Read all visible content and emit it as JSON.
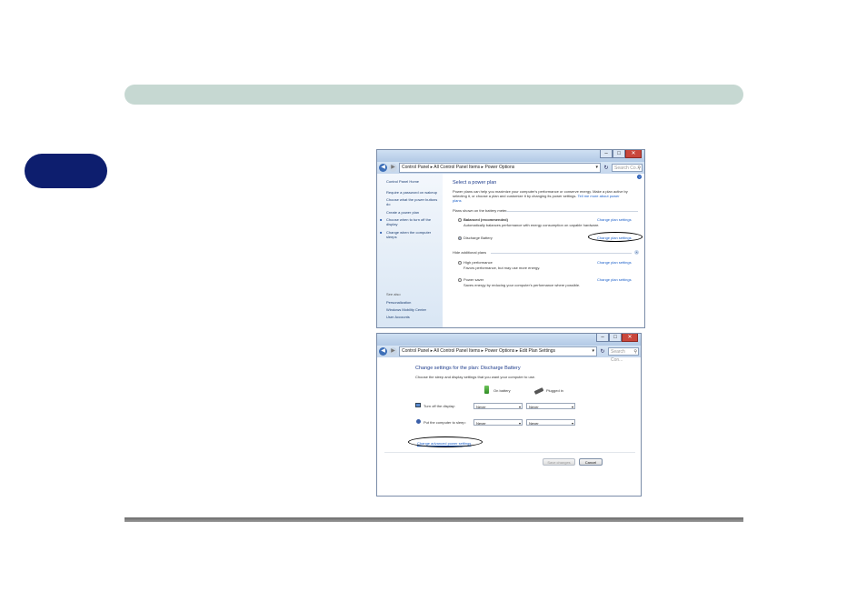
{
  "window1": {
    "address": "Control Panel  ▸  All Control Panel Items  ▸  Power Options",
    "search_placeholder": "Search Co...",
    "sidebar": {
      "home": "Control Panel Home",
      "items": [
        "Require a password on wakeup",
        "Choose what the power buttons do",
        "Create a power plan",
        "Choose when to turn off the display",
        "Change when the computer sleeps"
      ],
      "see_also": "See also",
      "links": [
        "Personalization",
        "Windows Mobility Center",
        "User Accounts"
      ]
    },
    "heading": "Select a power plan",
    "intro_line1": "Power plans can help you maximize your computer's performance or conserve energy. Make a plan active by",
    "intro_line2": "selecting it, or choose a plan and customize it by changing its power settings.",
    "intro_link": "Tell me more about power",
    "intro_link2": "plans",
    "battery_meter_label": "Plans shown on the battery meter",
    "plans": [
      {
        "name": "Balanced (recommended)",
        "desc": "Automatically balances performance with energy consumption on capable hardware.",
        "link": "Change plan settings",
        "selected": false
      },
      {
        "name": "Discharge Battery",
        "desc": "",
        "link": "Change plan settings",
        "selected": true
      }
    ],
    "hide_label": "Hide additional plans",
    "extra_plans": [
      {
        "name": "High performance",
        "desc": "Favors performance, but may use more energy.",
        "link": "Change plan settings"
      },
      {
        "name": "Power saver",
        "desc": "Saves energy by reducing your computer's performance where possible.",
        "link": "Change plan settings"
      }
    ]
  },
  "window2": {
    "address": "Control Panel  ▸  All Control Panel Items  ▸  Power Options  ▸  Edit Plan Settings",
    "search_placeholder": "Search Con...",
    "heading": "Change settings for the plan: Discharge Battery",
    "subheading": "Choose the sleep and display settings that you want your computer to use.",
    "on_battery": "On battery",
    "plugged_in": "Plugged in",
    "turn_off_display": "Turn off the display:",
    "put_to_sleep": "Put the computer to sleep:",
    "never": "Never",
    "advanced_link": "Change advanced power settings",
    "save_button": "Save changes",
    "cancel_button": "Cancel"
  }
}
